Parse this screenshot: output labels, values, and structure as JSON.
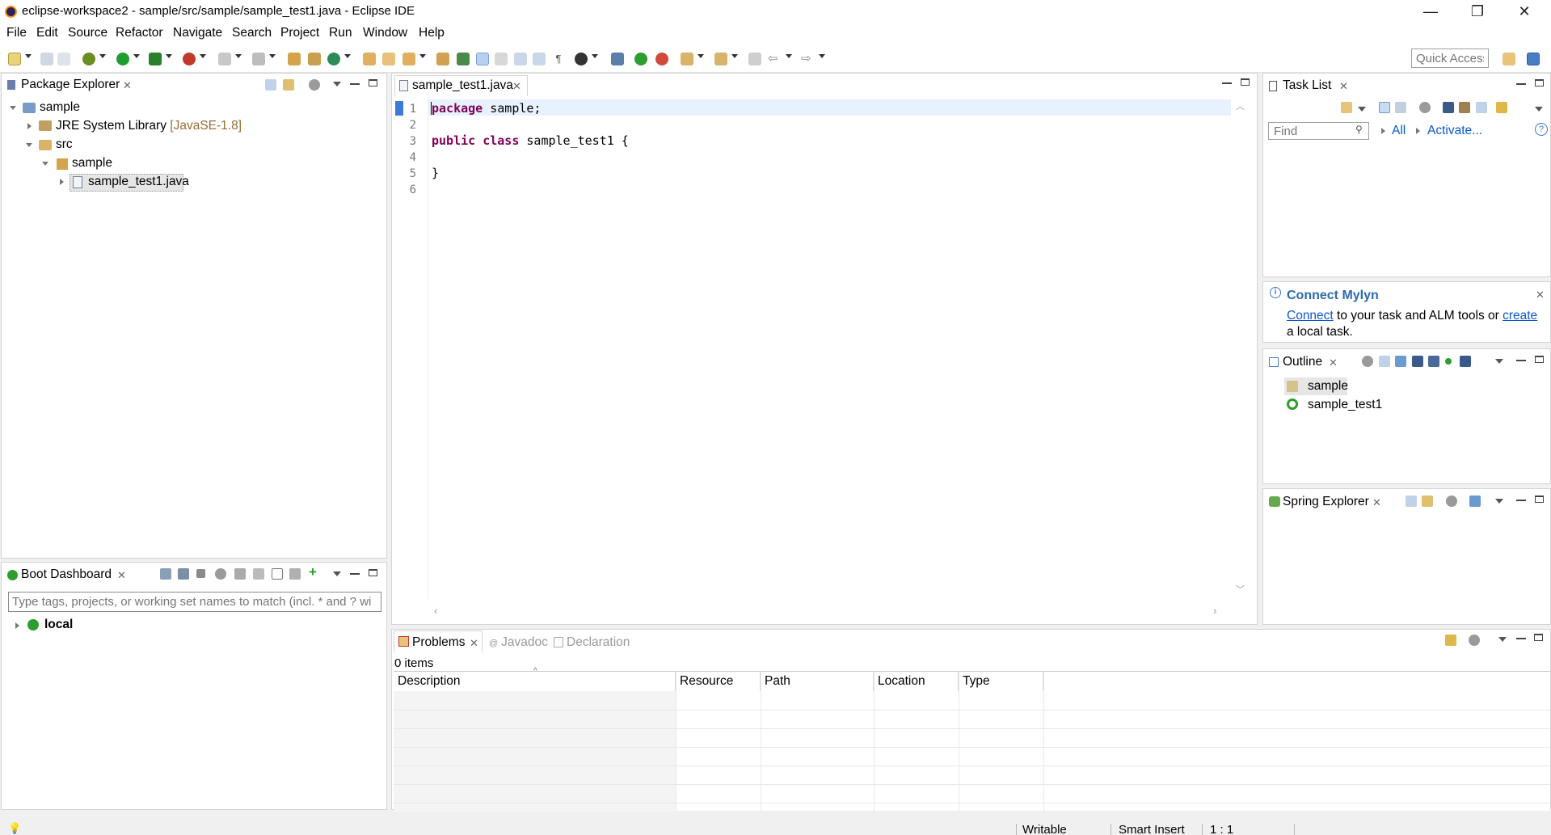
{
  "window": {
    "title": "eclipse-workspace2 - sample/src/sample/sample_test1.java - Eclipse IDE",
    "minimize": "—",
    "restore": "❐",
    "close": "✕"
  },
  "menu": [
    "File",
    "Edit",
    "Source",
    "Refactor",
    "Navigate",
    "Search",
    "Project",
    "Run",
    "Window",
    "Help"
  ],
  "toolbar": {
    "quick_access": "Quick Access",
    "colors": {
      "run": "#1f9d2f",
      "debug": "#6b8e23",
      "accent": "#3a7bd5"
    }
  },
  "package_explorer": {
    "title": "Package Explorer",
    "tree": {
      "project": "sample",
      "jre": "JRE System Library",
      "jre_version": "[JavaSE-1.8]",
      "src": "src",
      "package": "sample",
      "file": "sample_test1.java"
    }
  },
  "boot_dashboard": {
    "title": "Boot Dashboard",
    "filter_placeholder": "Type tags, projects, or working set names to match (incl. * and ? wi",
    "local": "local"
  },
  "editor": {
    "tab": "sample_test1.java",
    "line_numbers": [
      "1",
      "2",
      "3",
      "4",
      "5",
      "6"
    ],
    "lines": [
      {
        "kw": "package",
        "rest": " sample;"
      },
      {
        "kw": "",
        "rest": ""
      },
      {
        "kw": "public class",
        "rest": " sample_test1 {"
      },
      {
        "kw": "",
        "rest": ""
      },
      {
        "kw": "",
        "rest": "}"
      },
      {
        "kw": "",
        "rest": ""
      }
    ]
  },
  "task_list": {
    "title": "Task List",
    "find_placeholder": "Find",
    "all": "All",
    "activate": "Activate..."
  },
  "mylyn": {
    "title": "Connect Mylyn",
    "connect": "Connect",
    "text1": " to your task and ALM tools or ",
    "create": "create",
    "text2": "a local task."
  },
  "outline": {
    "title": "Outline",
    "items": [
      "sample",
      "sample_test1"
    ]
  },
  "spring_explorer": {
    "title": "Spring Explorer"
  },
  "problems": {
    "tabs": [
      "Problems",
      "Javadoc",
      "Declaration"
    ],
    "count": "0 items",
    "columns": [
      "Description",
      "Resource",
      "Path",
      "Location",
      "Type"
    ]
  },
  "status": {
    "writable": "Writable",
    "insert_mode": "Smart Insert",
    "position": "1 : 1"
  }
}
